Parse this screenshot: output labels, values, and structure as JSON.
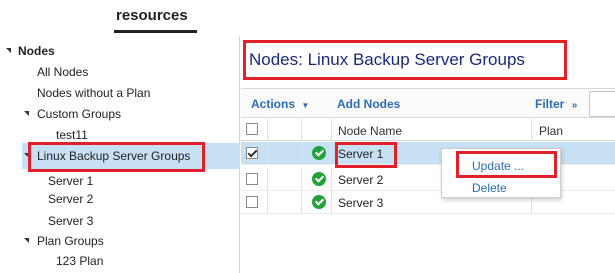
{
  "tabs": {
    "resources": "resources"
  },
  "tree": {
    "nodes_label": "Nodes",
    "all_nodes": "All Nodes",
    "nodes_without_plan": "Nodes without a Plan",
    "custom_groups": "Custom Groups",
    "test11": "test11",
    "linux_backup_server_groups": "Linux Backup Server Groups",
    "server1": "Server 1",
    "server2": "Server 2",
    "server3": "Server 3",
    "plan_groups": "Plan Groups",
    "plan_123": "123 Plan"
  },
  "main": {
    "title": "Nodes:  Linux Backup Server Groups",
    "toolbar": {
      "actions": "Actions",
      "add_nodes": "Add Nodes",
      "filter": "Filter"
    },
    "columns": {
      "node_name": "Node Name",
      "plan": "Plan"
    },
    "rows": [
      {
        "name": "Server 1",
        "checked": true,
        "status": "ok"
      },
      {
        "name": "Server 2",
        "checked": false,
        "status": "ok"
      },
      {
        "name": "Server 3",
        "checked": false,
        "status": "ok"
      }
    ],
    "context_menu": {
      "update": "Update ...",
      "delete": "Delete"
    }
  },
  "colors": {
    "selection": "#c8e0f4",
    "highlight_box": "#e0202a",
    "link": "#2a6cb8",
    "title": "#1a2a7a",
    "status_ok": "#22a23a"
  }
}
